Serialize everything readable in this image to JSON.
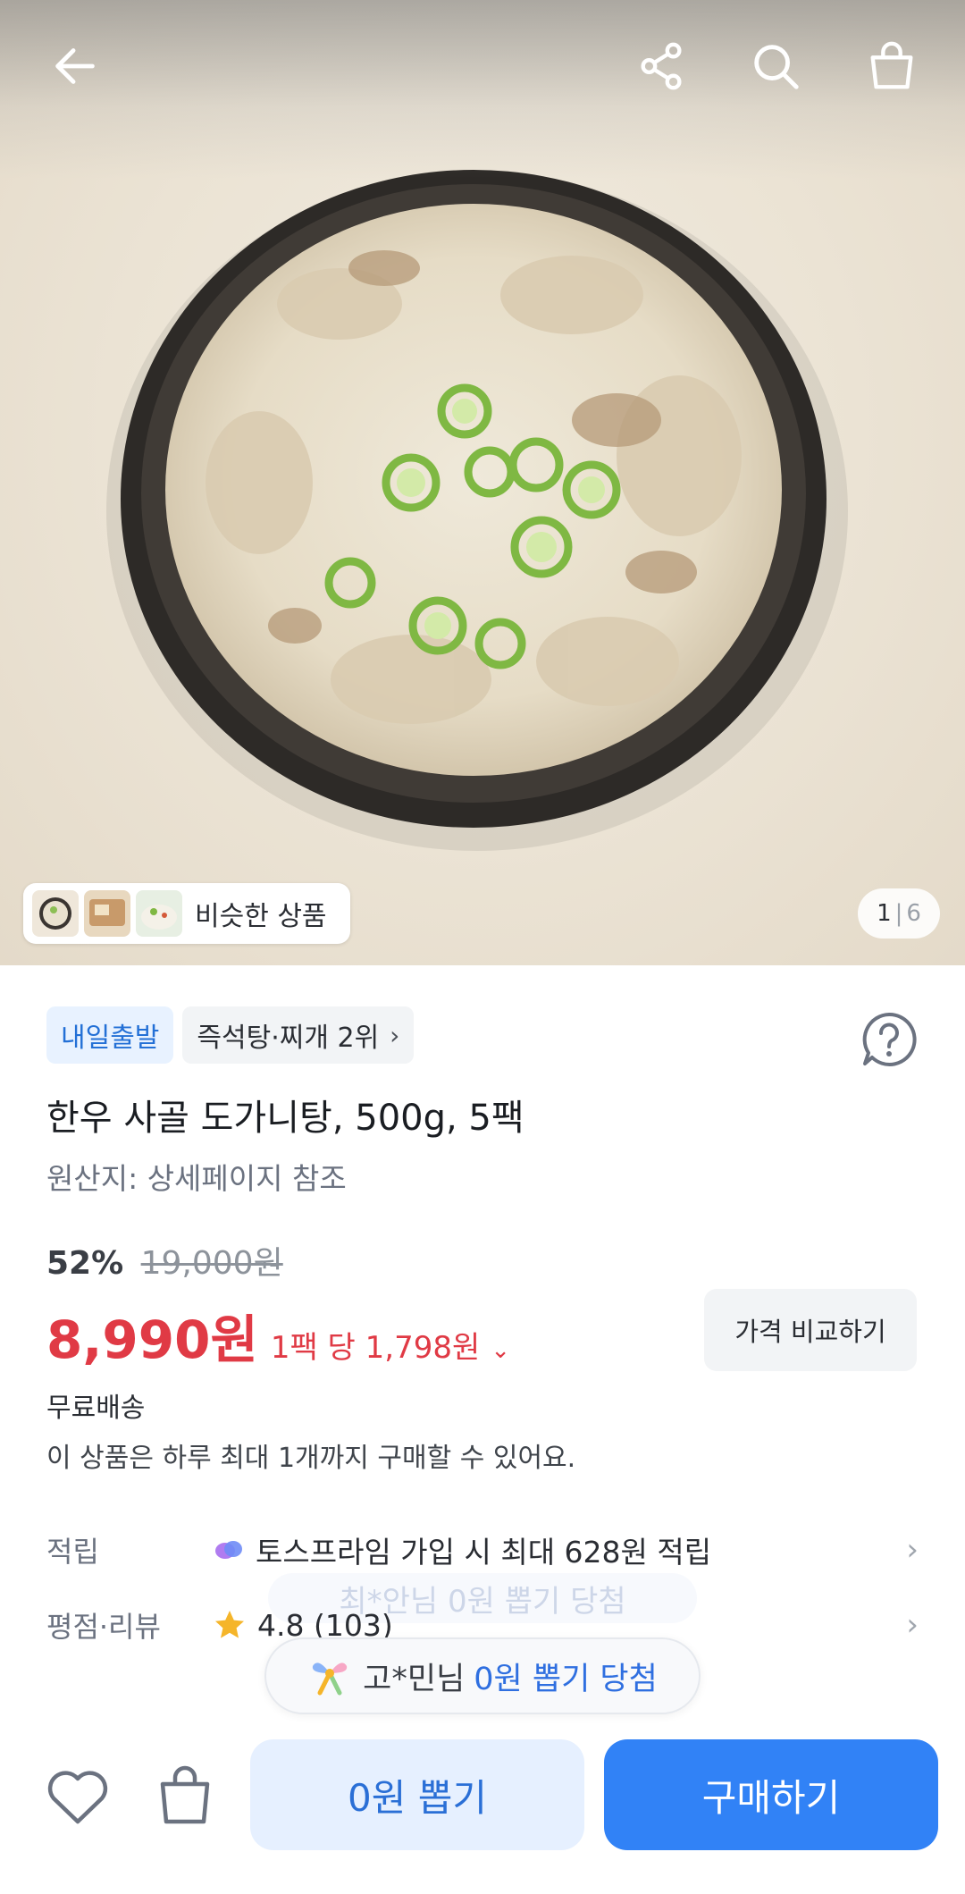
{
  "header": {
    "back_icon": "arrow-left-icon",
    "share_icon": "share-icon",
    "search_icon": "search-icon",
    "cart_icon": "shopping-bag-icon"
  },
  "gallery": {
    "similar_label": "비슷한 상품",
    "page_current": "1",
    "page_separator": "|",
    "page_total": "6"
  },
  "product": {
    "badge_delivery": "내일출발",
    "badge_rank": "즉석탕·찌개 2위",
    "title": "한우 사골 도가니탕, 500g, 5팩",
    "origin": "원산지: 상세페이지 참조",
    "discount_pct": "52%",
    "original_price": "19,000원",
    "price": "8,990원",
    "unit_price": "1팩 당 1,798원",
    "compare_label": "가격 비교하기",
    "shipping": "무료배송",
    "purchase_limit": "이 상품은 하루 최대 1개까지 구매할 수 있어요."
  },
  "info_rows": {
    "points_key": "적립",
    "points_value": "토스프라임 가입 시 최대 628원 적립",
    "rating_key": "평점·리뷰",
    "rating_value": "4.8 (103)"
  },
  "toasts": {
    "ghost": "최*안님 0원 뽑기 당첨",
    "main_name": "고*민님",
    "main_highlight": "0원 뽑기 당첨"
  },
  "bottom": {
    "draw_label": "0원 뽑기",
    "buy_label": "구매하기"
  },
  "colors": {
    "accent_blue": "#3182f6",
    "price_red": "#e03a45"
  }
}
